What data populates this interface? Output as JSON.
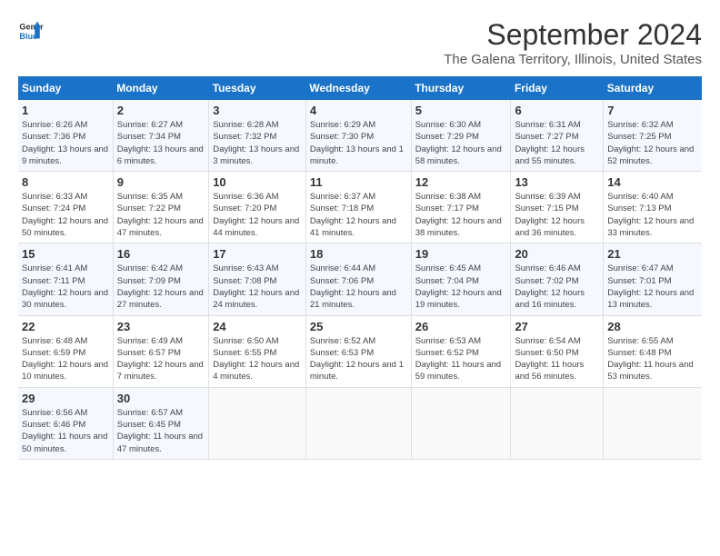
{
  "logo": {
    "line1": "General",
    "line2": "Blue"
  },
  "title": "September 2024",
  "subtitle": "The Galena Territory, Illinois, United States",
  "days_header": [
    "Sunday",
    "Monday",
    "Tuesday",
    "Wednesday",
    "Thursday",
    "Friday",
    "Saturday"
  ],
  "weeks": [
    [
      {
        "num": "1",
        "sunrise": "6:26 AM",
        "sunset": "7:36 PM",
        "daylight": "13 hours and 9 minutes."
      },
      {
        "num": "2",
        "sunrise": "6:27 AM",
        "sunset": "7:34 PM",
        "daylight": "13 hours and 6 minutes."
      },
      {
        "num": "3",
        "sunrise": "6:28 AM",
        "sunset": "7:32 PM",
        "daylight": "13 hours and 3 minutes."
      },
      {
        "num": "4",
        "sunrise": "6:29 AM",
        "sunset": "7:30 PM",
        "daylight": "13 hours and 1 minute."
      },
      {
        "num": "5",
        "sunrise": "6:30 AM",
        "sunset": "7:29 PM",
        "daylight": "12 hours and 58 minutes."
      },
      {
        "num": "6",
        "sunrise": "6:31 AM",
        "sunset": "7:27 PM",
        "daylight": "12 hours and 55 minutes."
      },
      {
        "num": "7",
        "sunrise": "6:32 AM",
        "sunset": "7:25 PM",
        "daylight": "12 hours and 52 minutes."
      }
    ],
    [
      {
        "num": "8",
        "sunrise": "6:33 AM",
        "sunset": "7:24 PM",
        "daylight": "12 hours and 50 minutes."
      },
      {
        "num": "9",
        "sunrise": "6:35 AM",
        "sunset": "7:22 PM",
        "daylight": "12 hours and 47 minutes."
      },
      {
        "num": "10",
        "sunrise": "6:36 AM",
        "sunset": "7:20 PM",
        "daylight": "12 hours and 44 minutes."
      },
      {
        "num": "11",
        "sunrise": "6:37 AM",
        "sunset": "7:18 PM",
        "daylight": "12 hours and 41 minutes."
      },
      {
        "num": "12",
        "sunrise": "6:38 AM",
        "sunset": "7:17 PM",
        "daylight": "12 hours and 38 minutes."
      },
      {
        "num": "13",
        "sunrise": "6:39 AM",
        "sunset": "7:15 PM",
        "daylight": "12 hours and 36 minutes."
      },
      {
        "num": "14",
        "sunrise": "6:40 AM",
        "sunset": "7:13 PM",
        "daylight": "12 hours and 33 minutes."
      }
    ],
    [
      {
        "num": "15",
        "sunrise": "6:41 AM",
        "sunset": "7:11 PM",
        "daylight": "12 hours and 30 minutes."
      },
      {
        "num": "16",
        "sunrise": "6:42 AM",
        "sunset": "7:09 PM",
        "daylight": "12 hours and 27 minutes."
      },
      {
        "num": "17",
        "sunrise": "6:43 AM",
        "sunset": "7:08 PM",
        "daylight": "12 hours and 24 minutes."
      },
      {
        "num": "18",
        "sunrise": "6:44 AM",
        "sunset": "7:06 PM",
        "daylight": "12 hours and 21 minutes."
      },
      {
        "num": "19",
        "sunrise": "6:45 AM",
        "sunset": "7:04 PM",
        "daylight": "12 hours and 19 minutes."
      },
      {
        "num": "20",
        "sunrise": "6:46 AM",
        "sunset": "7:02 PM",
        "daylight": "12 hours and 16 minutes."
      },
      {
        "num": "21",
        "sunrise": "6:47 AM",
        "sunset": "7:01 PM",
        "daylight": "12 hours and 13 minutes."
      }
    ],
    [
      {
        "num": "22",
        "sunrise": "6:48 AM",
        "sunset": "6:59 PM",
        "daylight": "12 hours and 10 minutes."
      },
      {
        "num": "23",
        "sunrise": "6:49 AM",
        "sunset": "6:57 PM",
        "daylight": "12 hours and 7 minutes."
      },
      {
        "num": "24",
        "sunrise": "6:50 AM",
        "sunset": "6:55 PM",
        "daylight": "12 hours and 4 minutes."
      },
      {
        "num": "25",
        "sunrise": "6:52 AM",
        "sunset": "6:53 PM",
        "daylight": "12 hours and 1 minute."
      },
      {
        "num": "26",
        "sunrise": "6:53 AM",
        "sunset": "6:52 PM",
        "daylight": "11 hours and 59 minutes."
      },
      {
        "num": "27",
        "sunrise": "6:54 AM",
        "sunset": "6:50 PM",
        "daylight": "11 hours and 56 minutes."
      },
      {
        "num": "28",
        "sunrise": "6:55 AM",
        "sunset": "6:48 PM",
        "daylight": "11 hours and 53 minutes."
      }
    ],
    [
      {
        "num": "29",
        "sunrise": "6:56 AM",
        "sunset": "6:46 PM",
        "daylight": "11 hours and 50 minutes."
      },
      {
        "num": "30",
        "sunrise": "6:57 AM",
        "sunset": "6:45 PM",
        "daylight": "11 hours and 47 minutes."
      },
      null,
      null,
      null,
      null,
      null
    ]
  ]
}
